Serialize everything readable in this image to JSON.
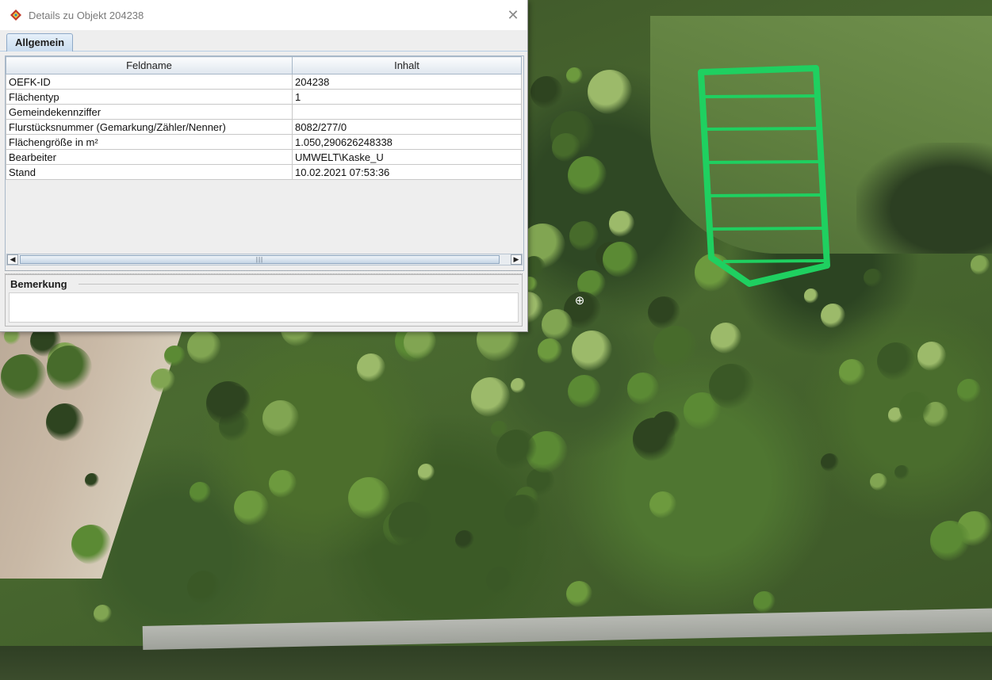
{
  "window": {
    "title": "Details zu Objekt 204238",
    "close_icon": "close-x"
  },
  "tabs": [
    {
      "label": "Allgemein",
      "selected": true
    }
  ],
  "table": {
    "columns": [
      "Feldname",
      "Inhalt"
    ],
    "rows": [
      {
        "field": "OEFK-ID",
        "value": "204238"
      },
      {
        "field": "Flächentyp",
        "value": "1"
      },
      {
        "field": "Gemeindekennziffer",
        "value": ""
      },
      {
        "field": "Flurstücksnummer (Gemarkung/Zähler/Nenner)",
        "value": "8082/277/0"
      },
      {
        "field": "Flächengröße in m²",
        "value": "1.050,290626248338"
      },
      {
        "field": "Bearbeiter",
        "value": "UMWELT\\Kaske_U"
      },
      {
        "field": "Stand",
        "value": "10.02.2021 07:53:36"
      }
    ]
  },
  "remarks": {
    "label": "Bemerkung",
    "value": ""
  },
  "map": {
    "polygon_color": "#1fd060",
    "cursor_icon": "crosshair-target-icon"
  }
}
